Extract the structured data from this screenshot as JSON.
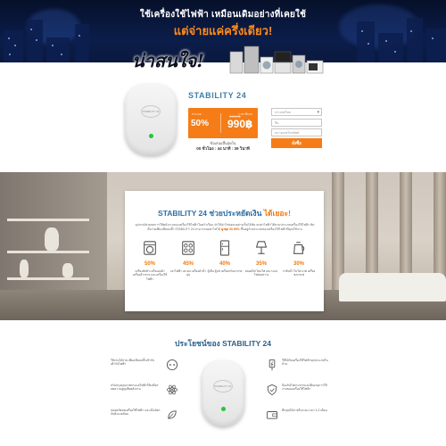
{
  "hero": {
    "line1": "ใช้เครื่องใช้ไฟฟ้า เหมือนเดิมอย่างที่เคยใช้",
    "line2": "แต่จ่ายแค่ครึ่งเดียว!",
    "slogan": "น่าสนใจ!"
  },
  "product": {
    "device_logo": "STABILITY 24",
    "title": "STABILITY 24",
    "price": {
      "discount_label": "ส่วนลด",
      "special_label": "ราคาพิเศษ",
      "old_price": "1980 ฿",
      "discount": "50%",
      "new_price": "990฿"
    },
    "countdown_label": "ข้อเสนอสิ้นสุดใน",
    "countdown": "00 ชั่วโมง : 44 นาที : 39 วินาที"
  },
  "form": {
    "country": "ประเทศไทย",
    "name_placeholder": "ชื่อ",
    "phone_placeholder": "หมายเลขโทรศัพท์",
    "submit": "สั่งซื้อ"
  },
  "savings": {
    "title_main": "STABILITY 24 ช่วยประหยัดเงิน",
    "title_highlight": "ได้เยอะ!",
    "desc_prefix": "อุปกรณ์ช่วยลดการใช้พลังงานของเครื่องใช้ไฟฟ้าในครัวเรือน ทำให้ค่าไฟลดลงอย่างเห็นได้ชัด ลดค่าไฟฟ้าได้ตามประเภทเครื่องใช้ไฟฟ้า ติดตั้งง่ายเพียงเสียบปลั๊ก STABILITY 24 สามารถลดค่าไฟได้",
    "desc_highlight": "สูงสุด 30-50%",
    "desc_suffix": "ขึ้นอยู่กับประเภทของเครื่องใช้ไฟฟ้าที่คุณใช้งาน",
    "items": [
      {
        "icon": "washing-machine-icon",
        "percent": "50%",
        "text": "เครื่องซักผ้า เครื่องอบผ้า เครื่องล้างจาน และเครื่องใช้ไฟฟ้า"
      },
      {
        "icon": "stove-icon",
        "percent": "45%",
        "text": "เตาไฟฟ้า เตาอบ เครื่องทำน้ำอุ่น"
      },
      {
        "icon": "fridge-icon",
        "percent": "40%",
        "text": "ตู้เย็น ตู้แช่ เครื่องปรับอากาศ"
      },
      {
        "icon": "lamp-icon",
        "percent": "35%",
        "text": "หลอดไฟ โคมไฟ และระบบไฟส่องสว่าง"
      },
      {
        "icon": "kettle-icon",
        "percent": "30%",
        "text": "กาต้มน้ำ ไมโครเวฟ เครื่องชงกาแฟ"
      }
    ]
  },
  "benefits": {
    "title": "ประโยชน์ของ STABILITY 24",
    "left": [
      {
        "icon": "socket-icon",
        "text": "ใช้งานได้ง่าย เพียงเสียบปลั๊กเข้ากับเต้ารับไฟฟ้า"
      },
      {
        "icon": "atom-icon",
        "text": "ปรับปรุงคุณภาพกระแสไฟฟ้าให้เสถียร ลดความสูญเสียพลังงาน"
      },
      {
        "icon": "leaf-icon",
        "text": "ปลอดภัยต่อเครื่องใช้ไฟฟ้า และเป็นมิตรกับสิ่งแวดล้อม"
      }
    ],
    "right": [
      {
        "icon": "plug-icon",
        "text": "ใช้ได้กับเครื่องใช้ไฟฟ้าทุกประเภทในบ้าน"
      },
      {
        "icon": "shield-icon",
        "text": "ป้องกันไฟกระชากและยืดอายุการใช้งานของเครื่องใช้ไฟฟ้า"
      },
      {
        "icon": "wallet-icon",
        "text": "คืนทุนได้ภายในระยะเวลา 1-2 เดือน"
      }
    ]
  },
  "colors": {
    "accent": "#f57c17",
    "title_blue": "#2e6fa3",
    "hero_bg": "#0b1d4a",
    "led": "#22c53a"
  }
}
